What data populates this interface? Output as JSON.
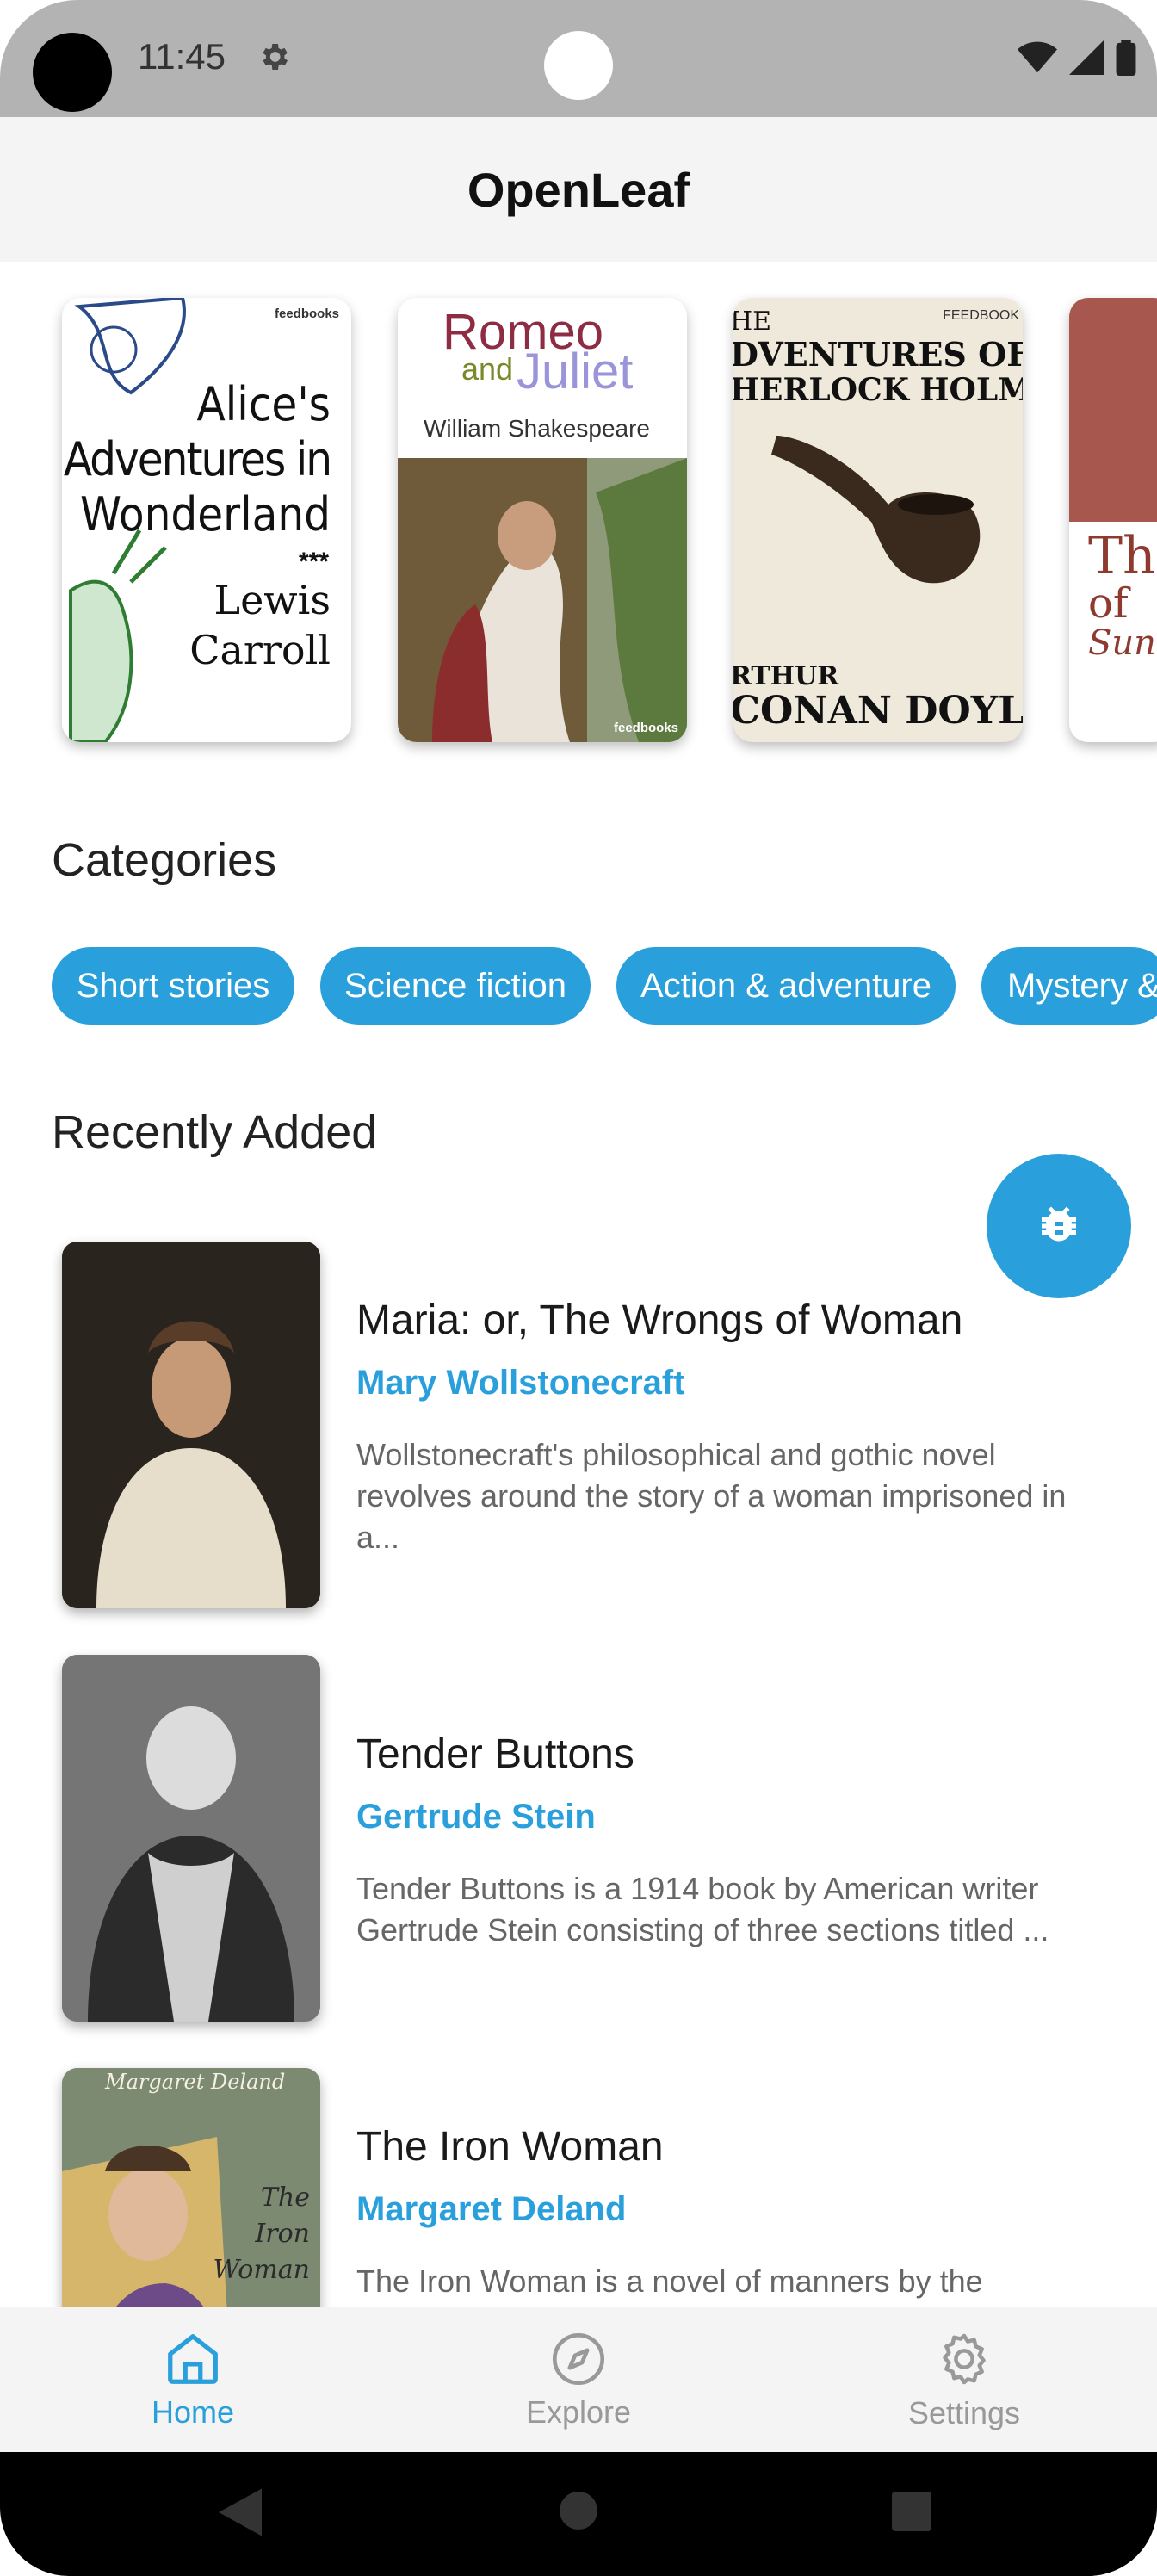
{
  "status_bar": {
    "time": "11:45"
  },
  "app_bar": {
    "title": "OpenLeaf"
  },
  "featured": [
    {
      "title_lines": [
        "Alice's",
        "Adventures in",
        "Wonderland"
      ],
      "stars": "***",
      "author_lines": [
        "Lewis",
        "Carroll"
      ],
      "publisher": "feedbooks"
    },
    {
      "title_word1": "Romeo",
      "title_word2": "and",
      "title_word3": "Juliet",
      "author": "William Shakespeare",
      "publisher": "feedbooks"
    },
    {
      "title_line1": "HE",
      "title_line2": "DVENTURES OF",
      "title_line3": "HERLOCK HOLME",
      "author_line1": "RTHUR",
      "author_line2": "CONAN DOYL",
      "publisher": "FEEDBOOK"
    },
    {
      "title_line1": "Th",
      "title_line2": "of",
      "title_line3": "Sun"
    }
  ],
  "categories": {
    "heading": "Categories",
    "chips": [
      "Short stories",
      "Science fiction",
      "Action & adventure",
      "Mystery &"
    ]
  },
  "recently_added": {
    "heading": "Recently Added",
    "books": [
      {
        "title": "Maria: or, The Wrongs of Woman",
        "author": "Mary Wollstonecraft",
        "desc_lines": [
          "Wollstonecraft's philosophical and gothic novel",
          "revolves around the story of a woman imprisoned in",
          "a..."
        ]
      },
      {
        "title": "Tender Buttons",
        "author": "Gertrude Stein",
        "desc_lines": [
          "Tender Buttons is a 1914 book by American writer",
          "Gertrude Stein consisting of three sections titled ..."
        ]
      },
      {
        "title": "The Iron Woman",
        "author": "Margaret Deland",
        "desc_lines": [
          "The Iron Woman is a novel of manners by the"
        ],
        "cover_text": [
          "Margaret Deland",
          "The",
          "Iron",
          "Woman"
        ]
      }
    ]
  },
  "bottom_nav": [
    {
      "label": "Home",
      "icon": "home-icon",
      "active": true
    },
    {
      "label": "Explore",
      "icon": "compass-icon",
      "active": false
    },
    {
      "label": "Settings",
      "icon": "gear-icon",
      "active": false
    }
  ],
  "colors": {
    "accent": "#29a0dc",
    "inactive": "#999999"
  }
}
